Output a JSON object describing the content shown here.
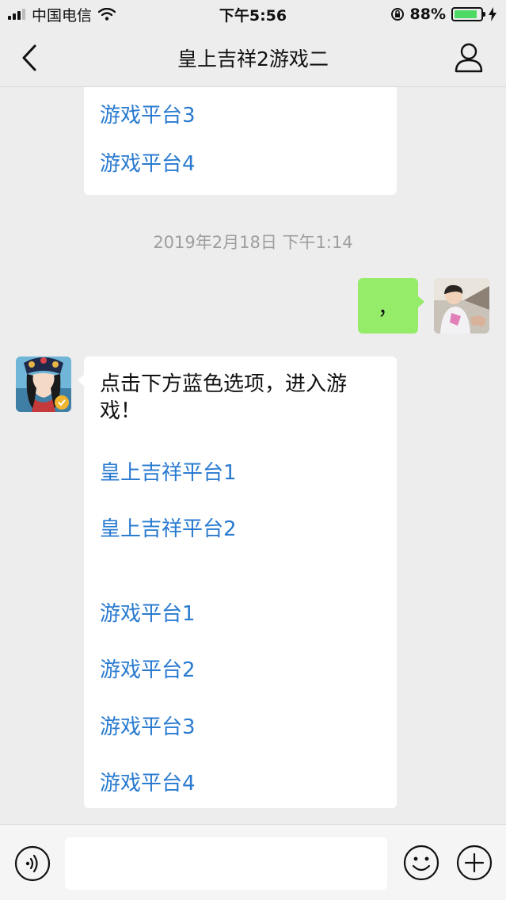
{
  "status_bar": {
    "carrier": "中国电信",
    "time": "下午5:56",
    "battery_percent": "88%",
    "battery_level": 0.88
  },
  "nav": {
    "title": "皇上吉祥2游戏二"
  },
  "messages": {
    "first_bubble_links": [
      "游戏平台3",
      "游戏平台4"
    ],
    "timestamp": "2019年2月18日 下午1:14",
    "outgoing_text": "，",
    "incoming_text": "点击下方蓝色选项，进入游戏！",
    "incoming_links": [
      "皇上吉祥平台1",
      "皇上吉祥平台2",
      "游戏平台1",
      "游戏平台2",
      "游戏平台3",
      "游戏平台4"
    ]
  },
  "input": {
    "placeholder": ""
  },
  "icons": {
    "back": "chevron-left-icon",
    "profile": "person-icon",
    "voice": "voice-icon",
    "emoji": "emoji-icon",
    "plus": "plus-icon"
  },
  "colors": {
    "link": "#2a7bd0",
    "outgoing_bubble": "#95ec69",
    "background": "#ededed"
  }
}
